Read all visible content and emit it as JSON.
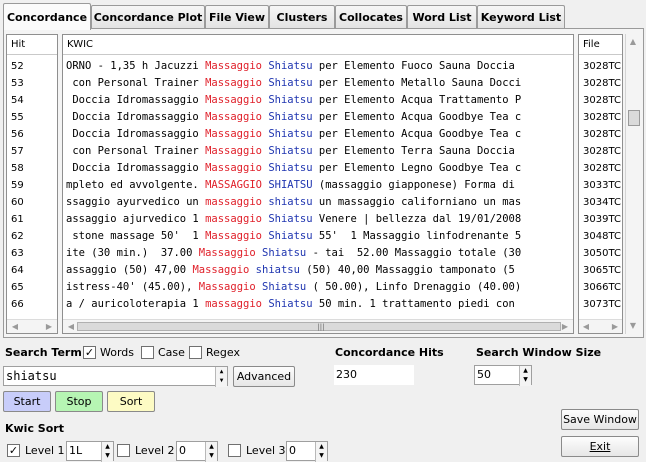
{
  "tabs": [
    "Concordance",
    "Concordance Plot",
    "File View",
    "Clusters",
    "Collocates",
    "Word List",
    "Keyword List"
  ],
  "headers": {
    "hit": "Hit",
    "kwic": "KWIC",
    "file": "File"
  },
  "rows": [
    {
      "hit": "52",
      "left": "ORNO - 1,35 h Jacuzzi ",
      "kw1": "Massaggio",
      "kw2": "Shiatsu",
      "right": " per Elemento Fuoco Sauna Doccia",
      "file": "3028TC"
    },
    {
      "hit": "53",
      "left": " con Personal Trainer ",
      "kw1": "Massaggio",
      "kw2": "Shiatsu",
      "right": " per Elemento Metallo Sauna Docci",
      "file": "3028TC"
    },
    {
      "hit": "54",
      "left": " Doccia Idromassaggio ",
      "kw1": "Massaggio",
      "kw2": "Shiatsu",
      "right": " per Elemento Acqua Trattamento P",
      "file": "3028TC"
    },
    {
      "hit": "55",
      "left": " Doccia Idromassaggio ",
      "kw1": "Massaggio",
      "kw2": "Shiatsu",
      "right": " per Elemento Acqua Goodbye Tea c",
      "file": "3028TC"
    },
    {
      "hit": "56",
      "left": " Doccia Idromassaggio ",
      "kw1": "Massaggio",
      "kw2": "Shiatsu",
      "right": " per Elemento Acqua Goodbye Tea c",
      "file": "3028TC"
    },
    {
      "hit": "57",
      "left": " con Personal Trainer ",
      "kw1": "Massaggio",
      "kw2": "Shiatsu",
      "right": " per Elemento Terra Sauna Doccia",
      "file": "3028TC"
    },
    {
      "hit": "58",
      "left": " Doccia Idromassaggio ",
      "kw1": "Massaggio",
      "kw2": "Shiatsu",
      "right": " per Elemento Legno Goodbye Tea c",
      "file": "3028TC"
    },
    {
      "hit": "59",
      "left": "mpleto ed avvolgente. ",
      "kw1": "MASSAGGIO",
      "kw2": "SHIATSU",
      "right": " (massaggio giapponese) Forma di",
      "file": "3033TC"
    },
    {
      "hit": "60",
      "left": "ssaggio ayurvedico un ",
      "kw1": "massaggio",
      "kw2": "shiatsu",
      "right": " un massaggio californiano un mas",
      "file": "3034TC"
    },
    {
      "hit": "61",
      "left": "assaggio ajurvedico 1 ",
      "kw1": "massaggio",
      "kw2": "Shiatsu",
      "right": " Venere | bellezza dal 19/01/2008",
      "file": "3039TC"
    },
    {
      "hit": "62",
      "left": " stone massage 50'  1 ",
      "kw1": "Massaggio",
      "kw2": "Shiatsu",
      "right": " 55'  1 Massaggio linfodrenante 5",
      "file": "3048TC"
    },
    {
      "hit": "63",
      "left": "ite (30 min.)  37.00 ",
      "kw1": "Massaggio",
      "kw2": "Shiatsu",
      "right": " - tai  52.00 Massaggio totale (30",
      "file": "3050TC"
    },
    {
      "hit": "64",
      "left": "assaggio (50) 47,00 ",
      "kw1": "Massaggio",
      "kw2": "shiatsu",
      "right": " (50) 40,00 Massaggio tamponato (5",
      "file": "3065TC"
    },
    {
      "hit": "65",
      "left": "istress-40' (45.00), ",
      "kw1": "Massaggio",
      "kw2": "Shiatsu",
      "right": " ( 50.00), Linfo Drenaggio (40.00)",
      "file": "3066TC"
    },
    {
      "hit": "66",
      "left": "a / auricoloterapia 1 ",
      "kw1": "massaggio",
      "kw2": "Shiatsu",
      "right": " 50 min. 1 trattamento piedi con",
      "file": "3073TC"
    }
  ],
  "search": {
    "term_label": "Search Term",
    "words_label": "Words",
    "words_checked": true,
    "case_label": "Case",
    "case_checked": false,
    "regex_label": "Regex",
    "regex_checked": false,
    "value": "shiatsu",
    "advanced_label": "Advanced"
  },
  "hits": {
    "label": "Concordance Hits",
    "value": "230"
  },
  "window": {
    "label": "Search Window Size",
    "value": "50"
  },
  "buttons": {
    "start": "Start",
    "stop": "Stop",
    "sort": "Sort",
    "save_window": "Save Window",
    "exit": "Exit"
  },
  "colors": {
    "start": "#c8cdfa",
    "stop": "#b6f5b3",
    "sort": "#fdfbc4",
    "kw_red": "#e0202a",
    "kw_blue": "#1f35b0"
  },
  "kwic_sort": {
    "label": "Kwic Sort",
    "levels": [
      {
        "label": "Level 1",
        "checked": true,
        "value": "1L"
      },
      {
        "label": "Level 2",
        "checked": false,
        "value": "0"
      },
      {
        "label": "Level 3",
        "checked": false,
        "value": "0"
      }
    ]
  }
}
